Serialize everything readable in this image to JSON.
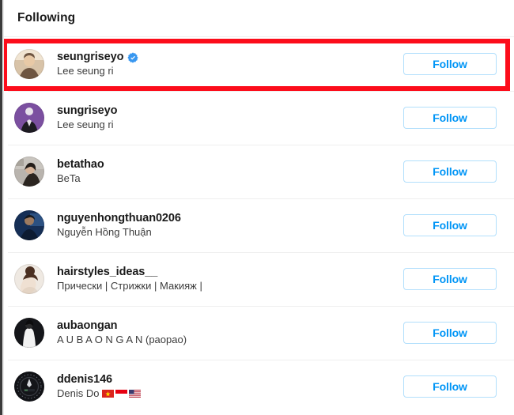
{
  "dialog": {
    "title": "Following"
  },
  "follow_label": "Follow",
  "accent": {
    "link_blue": "#0095f6",
    "button_border": "#b2dffc",
    "verified_blue": "#3897f0",
    "annotation_red": "#fc0d1b",
    "divider": "#efefef",
    "text_primary": "#1a1a1a",
    "text_secondary": "#3c3c3c"
  },
  "annotation": {
    "type": "red-rectangle-highlight",
    "target_row_index": 0,
    "color": "#fc0d1b"
  },
  "users": [
    {
      "username": "seungriseyo",
      "fullname": "Lee seung ri",
      "verified": true,
      "action_label": "Follow",
      "avatar": {
        "name": "avatar-seungriseyo",
        "bg": "#d8c3a8",
        "fg": "#6e5541",
        "accent": "#f0e4d2"
      },
      "highlighted": true
    },
    {
      "username": "sungriseyo",
      "fullname": "Lee seung ri",
      "verified": false,
      "action_label": "Follow",
      "avatar": {
        "name": "avatar-sungriseyo",
        "bg": "#7b4fa0",
        "fg": "#1d1b22",
        "accent": "#e7e1ea"
      },
      "highlighted": false
    },
    {
      "username": "betathao",
      "fullname": "BeTa",
      "verified": false,
      "action_label": "Follow",
      "avatar": {
        "name": "avatar-betathao",
        "bg": "#b9b4ae",
        "fg": "#2b2520",
        "accent": "#ddd8d1"
      },
      "highlighted": false
    },
    {
      "username": "nguyenhongthuan0206",
      "fullname": "Nguyễn Hồng Thuận",
      "verified": false,
      "action_label": "Follow",
      "avatar": {
        "name": "avatar-nguyenhongthuan0206",
        "bg": "#162f56",
        "fg": "#0d1b31",
        "accent": "#3f6ea8"
      },
      "highlighted": false
    },
    {
      "username": "hairstyles_ideas__",
      "fullname": "Прически | Стрижки | Макияж |",
      "verified": false,
      "action_label": "Follow",
      "avatar": {
        "name": "avatar-hairstyles-ideas",
        "bg": "#efe9e2",
        "fg": "#4a2f21",
        "accent": "#d9c7b6"
      },
      "highlighted": false
    },
    {
      "username": "aubaongan",
      "fullname": "A U B A O N G A N (paopao)",
      "verified": false,
      "action_label": "Follow",
      "avatar": {
        "name": "avatar-aubaongan",
        "bg": "#15161a",
        "fg": "#f2f2f2",
        "accent": "#8c8c8c"
      },
      "highlighted": false
    },
    {
      "username": "ddenis146",
      "fullname": "Denis Do",
      "verified": false,
      "action_label": "Follow",
      "flags": [
        "vietnam",
        "indonesia",
        "usa"
      ],
      "avatar": {
        "name": "avatar-ddenis146",
        "bg": "#111216",
        "fg": "#3a3d44",
        "accent": "#6f7580"
      },
      "highlighted": false
    }
  ]
}
